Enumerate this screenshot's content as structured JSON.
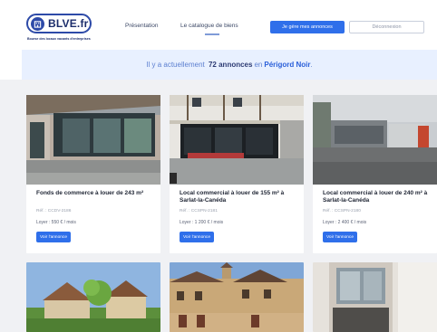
{
  "brand": {
    "name": "BLVE.fr",
    "tagline": "Bourse des locaux vacants d'entreprises"
  },
  "nav": {
    "presentation": "Présentation",
    "catalogue": "Le catalogue de biens"
  },
  "header_buttons": {
    "manage": "Je gère mes annonces",
    "logout": "Déconnexion"
  },
  "banner": {
    "prefix": "Il y a actuellement",
    "count": "72 annonces",
    "middle": "en",
    "region": "Périgord Noir",
    "suffix": "."
  },
  "listings": [
    {
      "title": "Fonds de commerce à louer de 243 m²",
      "ref": "Réf. : CCDV-2186",
      "price": "Loyer : 550 € / mois",
      "button": "Voir l'annonce"
    },
    {
      "title": "Local commercial à louer de 155 m² à Sarlat-la-Canéda",
      "ref": "Réf. : CCSPN-2181",
      "price": "Loyer : 1 200 € / mois",
      "button": "Voir l'annonce"
    },
    {
      "title": "Local commercial à louer de 240 m² à Sarlat-la-Canéda",
      "ref": "Réf. : CCSPN-2180",
      "price": "Loyer : 2 400 € / mois",
      "button": "Voir l'annonce"
    }
  ],
  "colors": {
    "primary": "#2f6fea",
    "brand": "#2d4aa8",
    "banner_bg": "#e8f0ff",
    "page_bg": "#f0f1f4"
  }
}
